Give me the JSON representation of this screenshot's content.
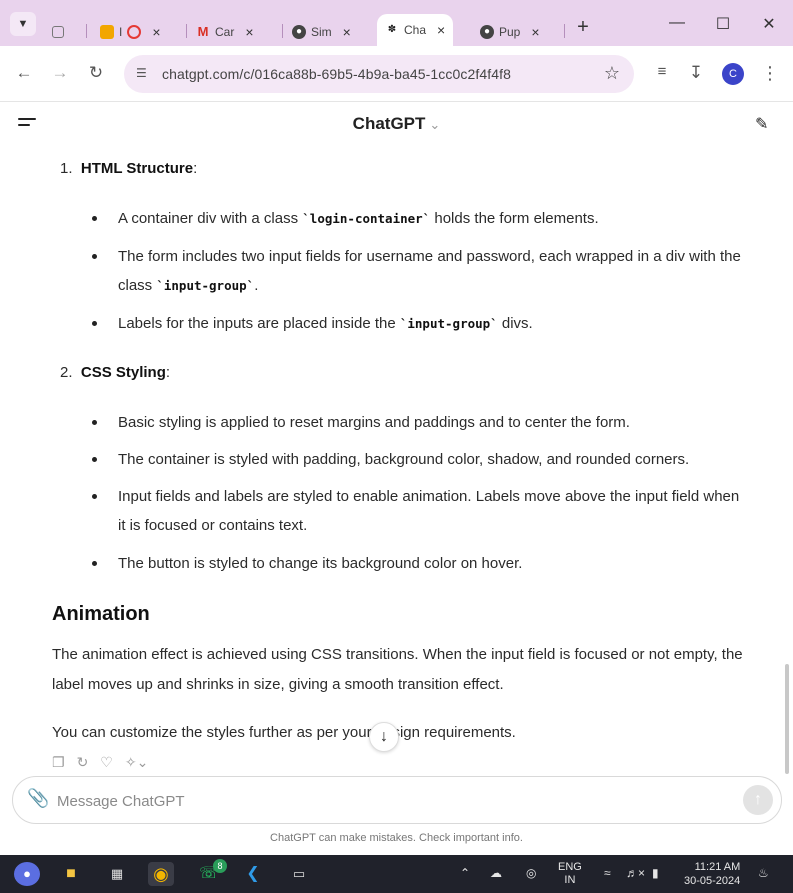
{
  "browser": {
    "tabs": [
      {
        "label": "I",
        "favicon": "youtube-icon",
        "color": "#e53935"
      },
      {
        "label": "Car",
        "favicon": "gmail-icon",
        "color": "#d93025"
      },
      {
        "label": "Sim",
        "favicon": "globe-icon",
        "color": "#444444"
      },
      {
        "label": "Cha",
        "favicon": "chatgpt-icon",
        "color": "#222222"
      },
      {
        "label": "Pup",
        "favicon": "globe-icon",
        "color": "#444444"
      }
    ],
    "url": "chatgpt.com/c/016ca88b-69b5-4b9a-ba45-1cc0c2f4f4f8",
    "avatar_letter": "C",
    "accent": "#e9d3ed"
  },
  "chat": {
    "model_title": "ChatGPT",
    "sections": [
      {
        "number": "1.",
        "title": "HTML Structure",
        "bullets": [
          {
            "pre": "A container div with a class ",
            "code": "`login-container`",
            "post": " holds the form elements."
          },
          {
            "pre": "The form includes two input fields for username and password, each wrapped in a div with the class ",
            "code": "`input-group`",
            "post": "."
          },
          {
            "pre": "Labels for the inputs are placed inside the ",
            "code": "`input-group`",
            "post": " divs."
          }
        ]
      },
      {
        "number": "2.",
        "title": "CSS Styling",
        "bullets": [
          {
            "text": "Basic styling is applied to reset margins and paddings and to center the form."
          },
          {
            "text": "The container is styled with padding, background color, shadow, and rounded corners."
          },
          {
            "text": "Input fields and labels are styled to enable animation. Labels move above the input field when it is focused or contains text."
          },
          {
            "text": "The button is styled to change its background color on hover."
          }
        ]
      }
    ],
    "animation_heading": "Animation",
    "animation_paragraph": "The animation effect is achieved using CSS transitions. When the input field is focused or not empty, the label moves up and shrinks in size, giving a smooth transition effect.",
    "closing_paragraph": "You can customize the styles further as per your design requirements.",
    "composer_placeholder": "Message ChatGPT",
    "disclaimer": "ChatGPT can make mistakes. Check important info."
  },
  "taskbar": {
    "lang_top": "ENG",
    "lang_bottom": "IN",
    "time": "11:21 AM",
    "date": "30-05-2024",
    "whatsapp_badge": "8"
  }
}
